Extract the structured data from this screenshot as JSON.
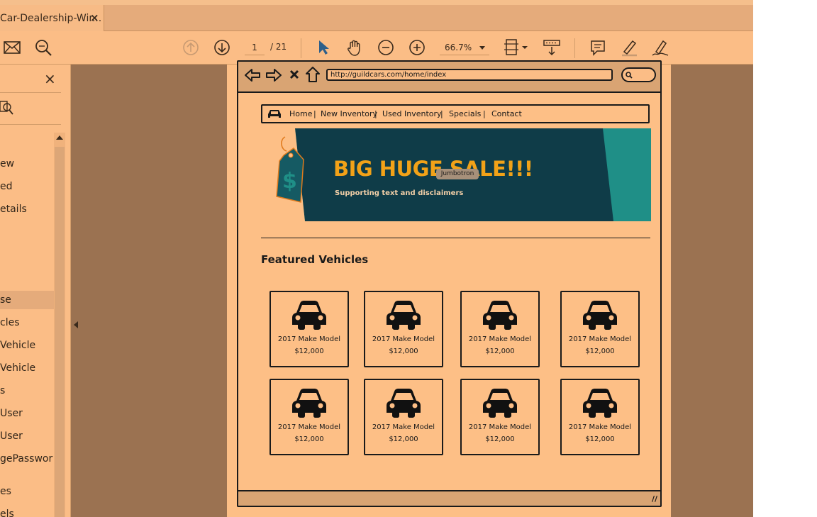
{
  "tab": {
    "title": "Car-Dealership-Wir...",
    "close": "×"
  },
  "toolbar": {
    "page_current": "1",
    "page_total": "/ 21",
    "zoom": "66.7%"
  },
  "sidebar": {
    "close": "×",
    "items": [
      {
        "label": "ew",
        "selected": false
      },
      {
        "label": "ed",
        "selected": false
      },
      {
        "label": "etails",
        "selected": false
      },
      {
        "label": "se",
        "selected": true
      },
      {
        "label": "cles",
        "selected": false
      },
      {
        "label": "Vehicle",
        "selected": false
      },
      {
        "label": "Vehicle",
        "selected": false
      },
      {
        "label": "s",
        "selected": false
      },
      {
        "label": "User",
        "selected": false
      },
      {
        "label": "User",
        "selected": false
      },
      {
        "label": "gePasswor",
        "selected": false
      },
      {
        "label": "es",
        "selected": false
      },
      {
        "label": "els",
        "selected": false
      }
    ]
  },
  "wireframe": {
    "url": "http://guildcars.com/home/index",
    "nav": {
      "links": [
        "Home",
        "New Inventory",
        "Used Inventory",
        "Specials",
        "Contact"
      ],
      "separator": "|"
    },
    "jumbotron": {
      "title": "BIG HUGE SALE!!!",
      "subtitle": "Supporting text and disclaimers",
      "label": "Jumbotron",
      "tag_symbol": "$"
    },
    "featured_title": "Featured Vehicles",
    "vehicles": [
      {
        "model": "2017 Make Model",
        "price": "$12,000"
      },
      {
        "model": "2017 Make Model",
        "price": "$12,000"
      },
      {
        "model": "2017 Make Model",
        "price": "$12,000"
      },
      {
        "model": "2017 Make Model",
        "price": "$12,000"
      },
      {
        "model": "2017 Make Model",
        "price": "$12,000"
      },
      {
        "model": "2017 Make Model",
        "price": "$12,000"
      },
      {
        "model": "2017 Make Model",
        "price": "$12,000"
      },
      {
        "model": "2017 Make Model",
        "price": "$12,000"
      }
    ],
    "resize_grip": "//"
  },
  "colors": {
    "app_bg": "#9b7251",
    "toolbar_bg": "#fbbd86",
    "page_bg": "#fdbf86",
    "jumbo_dark": "#0f3c48",
    "jumbo_teal": "#1f8f87",
    "sale_orange": "#f2a218",
    "select_blue": "#2e5f8a"
  },
  "icons": [
    "mail-icon",
    "zoom-search-icon",
    "prev-page-icon",
    "next-page-icon",
    "select-cursor-icon",
    "hand-icon",
    "zoom-out-icon",
    "zoom-in-icon",
    "fit-page-icon",
    "scroll-mode-icon",
    "comment-icon",
    "highlight-icon",
    "sign-icon"
  ]
}
